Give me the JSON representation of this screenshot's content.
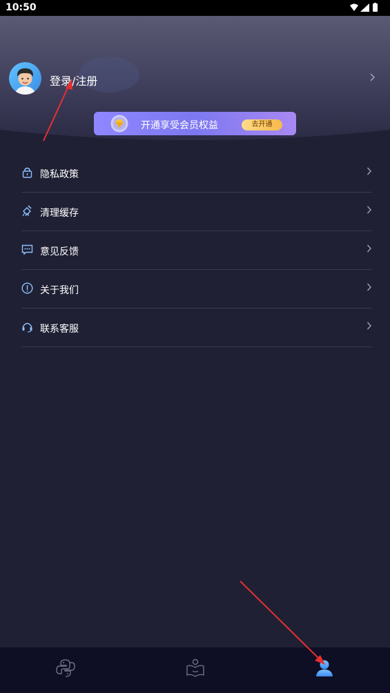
{
  "status_bar": {
    "time": "10:50"
  },
  "profile": {
    "login_label": "登录/注册"
  },
  "vip_banner": {
    "text": "开通享受会员权益",
    "button_label": "去开通"
  },
  "menu": [
    {
      "label": "隐私政策",
      "icon": "lock-icon"
    },
    {
      "label": "清理缓存",
      "icon": "broom-icon"
    },
    {
      "label": "意见反馈",
      "icon": "message-icon"
    },
    {
      "label": "关于我们",
      "icon": "info-icon"
    },
    {
      "label": "联系客服",
      "icon": "headset-icon"
    }
  ],
  "tab_bar": [
    {
      "icon": "python-icon",
      "active": false
    },
    {
      "icon": "book-reader-icon",
      "active": false
    },
    {
      "icon": "user-icon",
      "active": true
    }
  ],
  "colors": {
    "background": "#1f2034",
    "header_top": "#5a5872",
    "accent": "#5aa7ff",
    "vip_button": "#f7b94b",
    "annotation_arrow": "#e53030"
  }
}
